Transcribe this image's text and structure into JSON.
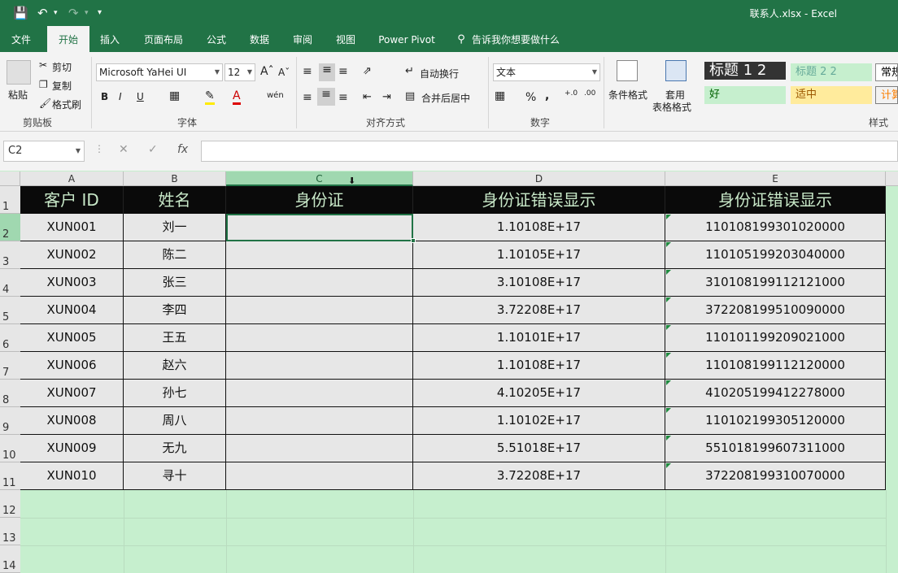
{
  "title_bar": {
    "file_title": "联系人.xlsx  -  Excel"
  },
  "tabs": [
    "文件",
    "开始",
    "插入",
    "页面布局",
    "公式",
    "数据",
    "审阅",
    "视图",
    "Power Pivot",
    "告诉我你想要做什么"
  ],
  "ribbon": {
    "clipboard": {
      "paste": "粘贴",
      "cut": "剪切",
      "copy": "复制",
      "format_painter": "格式刷",
      "label": "剪贴板"
    },
    "font": {
      "name": "Microsoft YaHei UI",
      "size": "12",
      "label": "字体",
      "bold": "B",
      "italic": "I",
      "underline": "U",
      "phonetic": "wén"
    },
    "alignment": {
      "wrap": "自动换行",
      "merge": "合并后居中",
      "label": "对齐方式"
    },
    "number": {
      "format": "文本",
      "percent": "%",
      "comma": ",",
      "label": "数字"
    },
    "styles": {
      "cond_format": "条件格式",
      "table_format_1": "套用",
      "table_format_2": "表格格式",
      "heading1": "标题 1 2",
      "heading2": "标题 2 2",
      "normal": "常规",
      "good": "好",
      "neutral": "适中",
      "calc": "计算",
      "label": "样式"
    }
  },
  "formula_bar": {
    "name_box": "C2",
    "cancel": "✕",
    "enter": "✓",
    "fx": "fx",
    "value": ""
  },
  "columns": [
    "A",
    "B",
    "C",
    "D",
    "E"
  ],
  "rows": [
    "1",
    "2",
    "3",
    "4",
    "5",
    "6",
    "7",
    "8",
    "9",
    "10",
    "11",
    "12",
    "13",
    "14"
  ],
  "table": {
    "headers": [
      "客户 ID",
      "姓名",
      "身份证",
      "身份证错误显示",
      "身份证错误显示"
    ],
    "rows": [
      [
        "XUN001",
        "刘一",
        "",
        "1.10108E+17",
        "110108199301020000"
      ],
      [
        "XUN002",
        "陈二",
        "",
        "1.10105E+17",
        "110105199203040000"
      ],
      [
        "XUN003",
        "张三",
        "",
        "3.10108E+17",
        "310108199112121000"
      ],
      [
        "XUN004",
        "李四",
        "",
        "3.72208E+17",
        "372208199510090000"
      ],
      [
        "XUN005",
        "王五",
        "",
        "1.10101E+17",
        "110101199209021000"
      ],
      [
        "XUN006",
        "赵六",
        "",
        "1.10108E+17",
        "110108199112120000"
      ],
      [
        "XUN007",
        "孙七",
        "",
        "4.10205E+17",
        "410205199412278000"
      ],
      [
        "XUN008",
        "周八",
        "",
        "1.10102E+17",
        "110102199305120000"
      ],
      [
        "XUN009",
        "无九",
        "",
        "5.51018E+17",
        "551018199607311000"
      ],
      [
        "XUN010",
        "寻十",
        "",
        "3.72208E+17",
        "372208199310070000"
      ]
    ]
  },
  "colors": {
    "excel_green": "#217346",
    "header_bg": "#0a0a0a",
    "header_text": "#c8e8c8",
    "sheet_bg": "#c6efce",
    "cell_bg": "#e7e7e7"
  }
}
